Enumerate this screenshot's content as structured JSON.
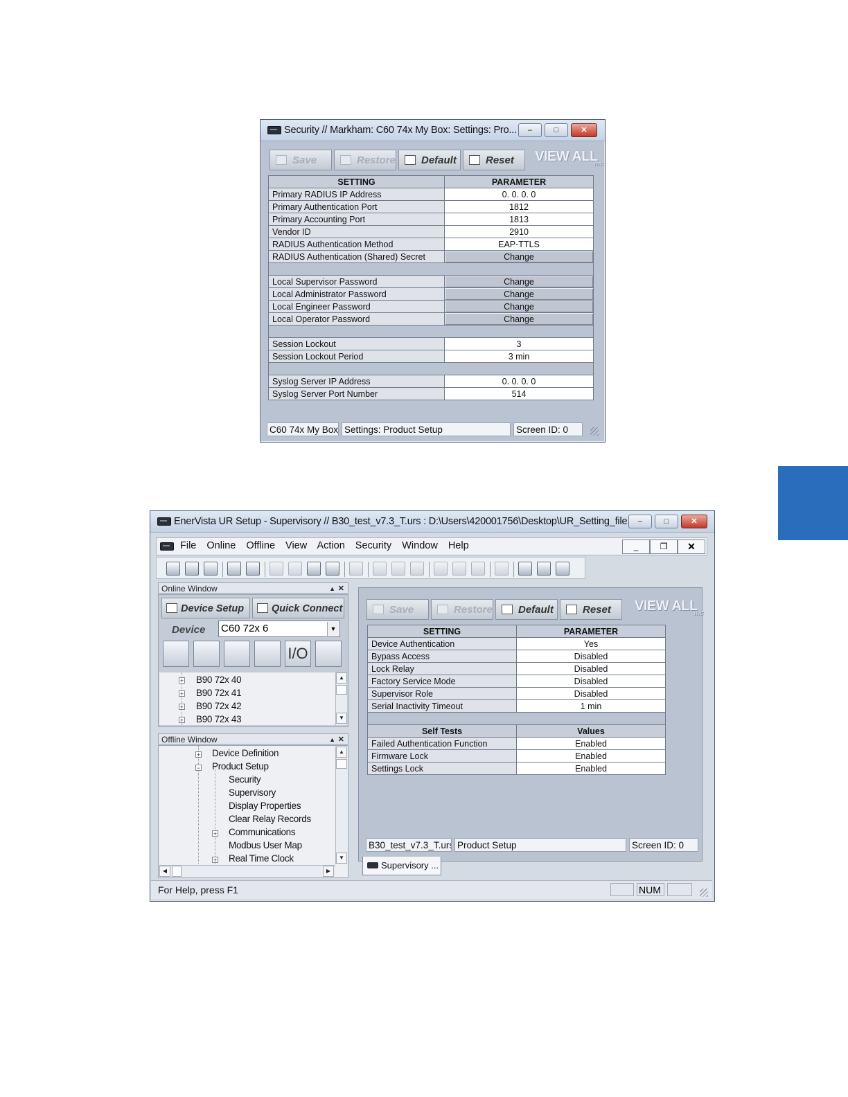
{
  "security_window": {
    "title": "Security // Markham: C60 74x My Box: Settings: Pro...",
    "toolbar": {
      "save": "Save",
      "restore": "Restore",
      "default": "Default",
      "reset": "Reset",
      "view_all": "VIEW ALL",
      "view_all_sub": "mc"
    },
    "headers": {
      "setting": "SETTING",
      "parameter": "PARAMETER"
    },
    "rows": [
      {
        "setting": "Primary RADIUS IP Address",
        "value": "0.  0.  0.  0"
      },
      {
        "setting": "Primary Authentication Port",
        "value": "1812"
      },
      {
        "setting": "Primary Accounting Port",
        "value": "1813"
      },
      {
        "setting": "Vendor ID",
        "value": "2910"
      },
      {
        "setting": "RADIUS Authentication Method",
        "value": "EAP-TTLS"
      },
      {
        "setting": "RADIUS Authentication (Shared) Secret",
        "value": "Change"
      },
      {
        "setting": "Local Supervisor Password",
        "value": "Change"
      },
      {
        "setting": "Local Administrator Password",
        "value": "Change"
      },
      {
        "setting": "Local Engineer Password",
        "value": "Change"
      },
      {
        "setting": "Local Operator Password",
        "value": "Change"
      },
      {
        "setting": "Session Lockout",
        "value": "3"
      },
      {
        "setting": "Session Lockout Period",
        "value": "3 min"
      },
      {
        "setting": "Syslog Server IP Address",
        "value": "0.  0.  0.  0"
      },
      {
        "setting": "Syslog Server Port Number",
        "value": "514"
      }
    ],
    "status": {
      "device": "C60 74x My Box",
      "location": "Settings: Product Setup",
      "screen": "Screen ID: 0"
    }
  },
  "main_window": {
    "title": "EnerVista UR Setup  - Supervisory // B30_test_v7.3_T.urs : D:\\Users\\420001756\\Desktop\\UR_Setting_file...",
    "menu": [
      "File",
      "Online",
      "Offline",
      "View",
      "Action",
      "Security",
      "Window",
      "Help"
    ],
    "online_window": {
      "title": "Online Window",
      "device_setup": "Device Setup",
      "quick_connect": "Quick Connect",
      "device_label": "Device",
      "device_value": "C60 72x 6",
      "io_label": "I/O",
      "tree": [
        "B90 72x 40",
        "B90 72x 41",
        "B90 72x 42",
        "B90 72x 43"
      ]
    },
    "offline_window": {
      "title": "Offline Window",
      "tree": [
        {
          "label": "Device Definition",
          "expander": "+"
        },
        {
          "label": "Product Setup",
          "expander": "-"
        },
        {
          "label": "Security",
          "expander": ""
        },
        {
          "label": "Supervisory",
          "expander": ""
        },
        {
          "label": "Display Properties",
          "expander": ""
        },
        {
          "label": "Clear Relay Records",
          "expander": ""
        },
        {
          "label": "Communications",
          "expander": "+"
        },
        {
          "label": "Modbus User Map",
          "expander": ""
        },
        {
          "label": "Real Time Clock",
          "expander": "+"
        }
      ]
    },
    "supervisory": {
      "toolbar": {
        "save": "Save",
        "restore": "Restore",
        "default": "Default",
        "reset": "Reset",
        "view_all": "VIEW ALL",
        "view_all_sub": "mc"
      },
      "headers": {
        "setting": "SETTING",
        "parameter": "PARAMETER"
      },
      "rows": [
        {
          "setting": "Device Authentication",
          "value": "Yes"
        },
        {
          "setting": "Bypass Access",
          "value": "Disabled"
        },
        {
          "setting": "Lock Relay",
          "value": "Disabled"
        },
        {
          "setting": "Factory Service Mode",
          "value": "Disabled"
        },
        {
          "setting": "Supervisor Role",
          "value": "Disabled"
        },
        {
          "setting": "Serial Inactivity Timeout",
          "value": "1 min"
        }
      ],
      "self_tests_headers": {
        "setting": "Self Tests",
        "parameter": "Values"
      },
      "self_tests": [
        {
          "setting": "Failed Authentication Function",
          "value": "Enabled"
        },
        {
          "setting": "Firmware Lock",
          "value": "Enabled"
        },
        {
          "setting": "Settings Lock",
          "value": "Enabled"
        }
      ],
      "status": {
        "file": "B30_test_v7.3_T.urs",
        "location": "Product Setup",
        "screen": "Screen ID: 0"
      },
      "tab": "Supervisory ..."
    },
    "statusbar": {
      "help": "For Help, press F1",
      "num": "NUM"
    }
  },
  "colors": {
    "accent_tab": "#2a6ebb",
    "window_bg": "#b9c3d2"
  }
}
